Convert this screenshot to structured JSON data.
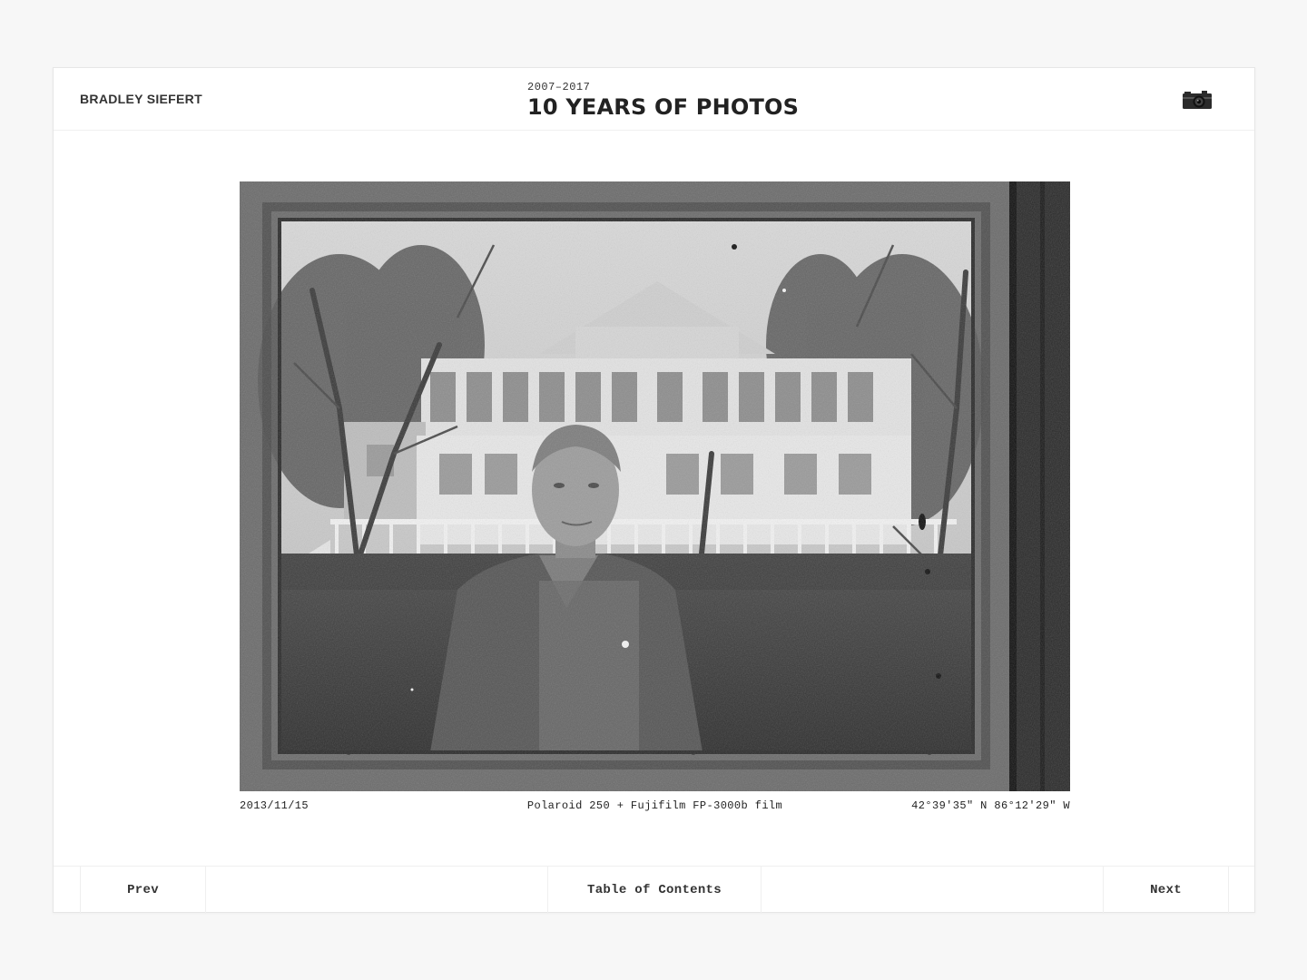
{
  "header": {
    "author": "BRADLEY SIEFERT",
    "years": "2007–2017",
    "title": "10 YEARS OF PHOTOS",
    "camera_icon": "camera-icon"
  },
  "photo": {
    "date": "2013/11/15",
    "film": "Polaroid 250 + Fujifilm FP-3000b film",
    "coords": "42°39′35″ N 86°12′29″ W"
  },
  "footer": {
    "prev_label": "Prev",
    "toc_label": "Table of Contents",
    "next_label": "Next"
  },
  "colors": {
    "background": "#f7f7f7",
    "card": "#ffffff",
    "text": "#222222"
  }
}
